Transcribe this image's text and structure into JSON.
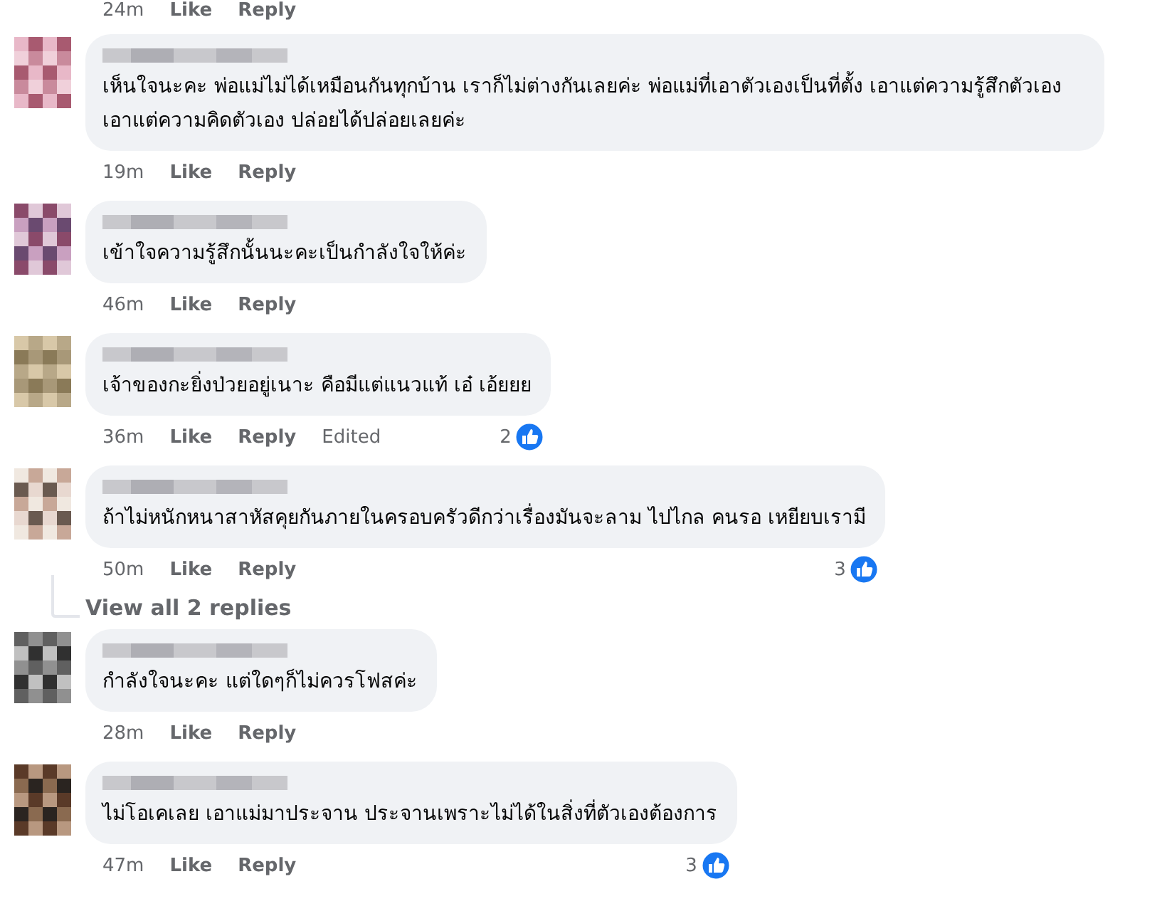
{
  "cut_meta": {
    "time": "24m",
    "like": "Like",
    "reply": "Reply"
  },
  "comments": [
    {
      "text": "เห็นใจนะคะ พ่อแม่ไม่ได้เหมือนกันทุกบ้าน เราก็ไม่ต่างกันเลยค่ะ พ่อแม่ที่เอาตัวเองเป็นที่ตั้ง เอาแต่ความรู้สึกตัวเอง เอาแต่ความคิดตัวเอง ปล่อยได้ปล่อยเลยค่ะ",
      "time": "19m",
      "like": "Like",
      "reply": "Reply"
    },
    {
      "text": "เข้าใจความรู้สึกนั้นนะคะเป็นกำลังใจให้ค่ะ",
      "time": "46m",
      "like": "Like",
      "reply": "Reply"
    },
    {
      "text": "เจ้าของกะยิ่งป่วยอยู่เนาะ คือมีแต่แนวแท้ เอ๋ เอ้ยยย",
      "time": "36m",
      "like": "Like",
      "reply": "Reply",
      "edited": "Edited",
      "reactions": "2"
    },
    {
      "text": "ถ้าไม่หนักหนาสาหัสคุยกันภายในครอบครัวดีกว่าเรื่องมันจะลาม ไปไกล คนรอ เหยียบเรามี",
      "time": "50m",
      "like": "Like",
      "reply": "Reply",
      "reactions": "3",
      "view_replies": "View all 2 replies"
    },
    {
      "text": "กำลังใจนะคะ แต่ใดๆก็ไม่ควรโฟสค่ะ",
      "time": "28m",
      "like": "Like",
      "reply": "Reply"
    },
    {
      "text": "ไม่โอเคเลย เอาแม่มาประจาน ประจานเพราะไม่ได้ในสิ่งที่ตัวเองต้องการ",
      "time": "47m",
      "like": "Like",
      "reply": "Reply",
      "reactions": "3"
    }
  ]
}
